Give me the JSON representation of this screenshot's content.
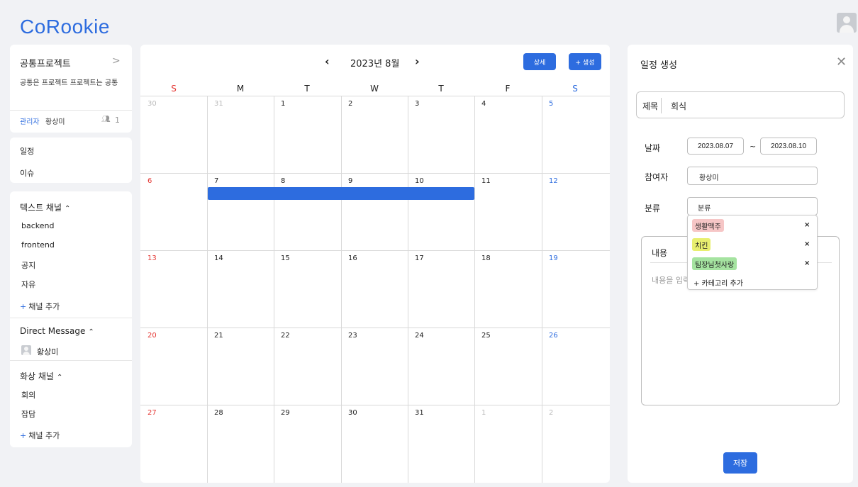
{
  "app": {
    "logo": "CoRookie"
  },
  "project": {
    "title": "공통프로젝트",
    "chevron": ">",
    "description": "공통은 프로젝트 프로젝트는 공통",
    "admin_label": "관리자",
    "admin_name": "황상미",
    "members_count": "1"
  },
  "nav": {
    "schedule": "일정",
    "issue": "이슈"
  },
  "text_channels": {
    "title": "텍스트 채널",
    "items": [
      "backend",
      "frontend",
      "공지",
      "자유"
    ],
    "add_label": "채널 추가"
  },
  "direct_message": {
    "title": "Direct Message",
    "user": "황상미"
  },
  "video_channels": {
    "title": "화상 채널",
    "items": [
      "회의",
      "잡담"
    ],
    "add_label": "채널 추가"
  },
  "calendar": {
    "month_label": "2023년 8월",
    "prev": "‹",
    "next": "›",
    "detail_button": "상세",
    "create_button": "+ 생성",
    "weekdays": [
      "S",
      "M",
      "T",
      "W",
      "T",
      "F",
      "S"
    ],
    "weeks": [
      [
        "30",
        "31",
        "1",
        "2",
        "3",
        "4",
        "5"
      ],
      [
        "6",
        "7",
        "8",
        "9",
        "10",
        "11",
        "12"
      ],
      [
        "13",
        "14",
        "15",
        "16",
        "17",
        "18",
        "19"
      ],
      [
        "20",
        "21",
        "22",
        "23",
        "24",
        "25",
        "26"
      ],
      [
        "27",
        "28",
        "29",
        "30",
        "31",
        "1",
        "2"
      ]
    ],
    "event": {
      "start_day": "7",
      "end_day": "10",
      "color": "#2d6cdf"
    }
  },
  "panel": {
    "title": "일정 생성",
    "title_label": "제목",
    "title_value": "회식",
    "date_label": "날짜",
    "date_start": "2023.08.07",
    "date_sep": "~",
    "date_end": "2023.08.10",
    "participant_label": "참여자",
    "participant_value": "황상미",
    "category_label": "분류",
    "category_value": "분류",
    "categories": [
      {
        "name": "생활맥주",
        "color": "#f6c6c6"
      },
      {
        "name": "치킨",
        "color": "#e8ef6f"
      },
      {
        "name": "팀장님첫사랑",
        "color": "#a5e3a0"
      }
    ],
    "add_category": "+ 카테고리 추가",
    "content_label": "내용",
    "content_placeholder": "내용을 입력",
    "save": "저장"
  },
  "colors": {
    "accent": "#2d6cdf",
    "sunday": "#e53935",
    "saturday": "#2d6cdf"
  }
}
